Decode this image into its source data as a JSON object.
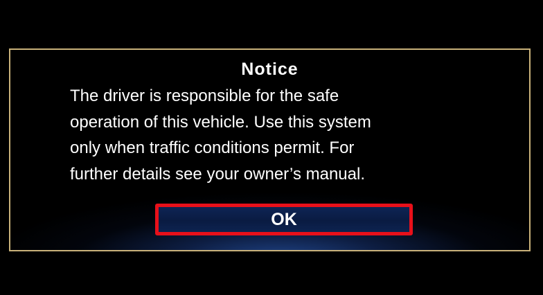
{
  "dialog": {
    "title": "Notice",
    "message_lines": [
      "The driver is responsible for the safe",
      "operation of this vehicle. Use this system",
      "only when traffic conditions permit. For",
      "further details see your owner’s manual."
    ],
    "ok_label": "OK"
  },
  "colors": {
    "background": "#000000",
    "dialog_border": "#c9b27a",
    "button_highlight": "#e8101a",
    "button_fill": "#0e2454",
    "text": "#ffffff"
  }
}
